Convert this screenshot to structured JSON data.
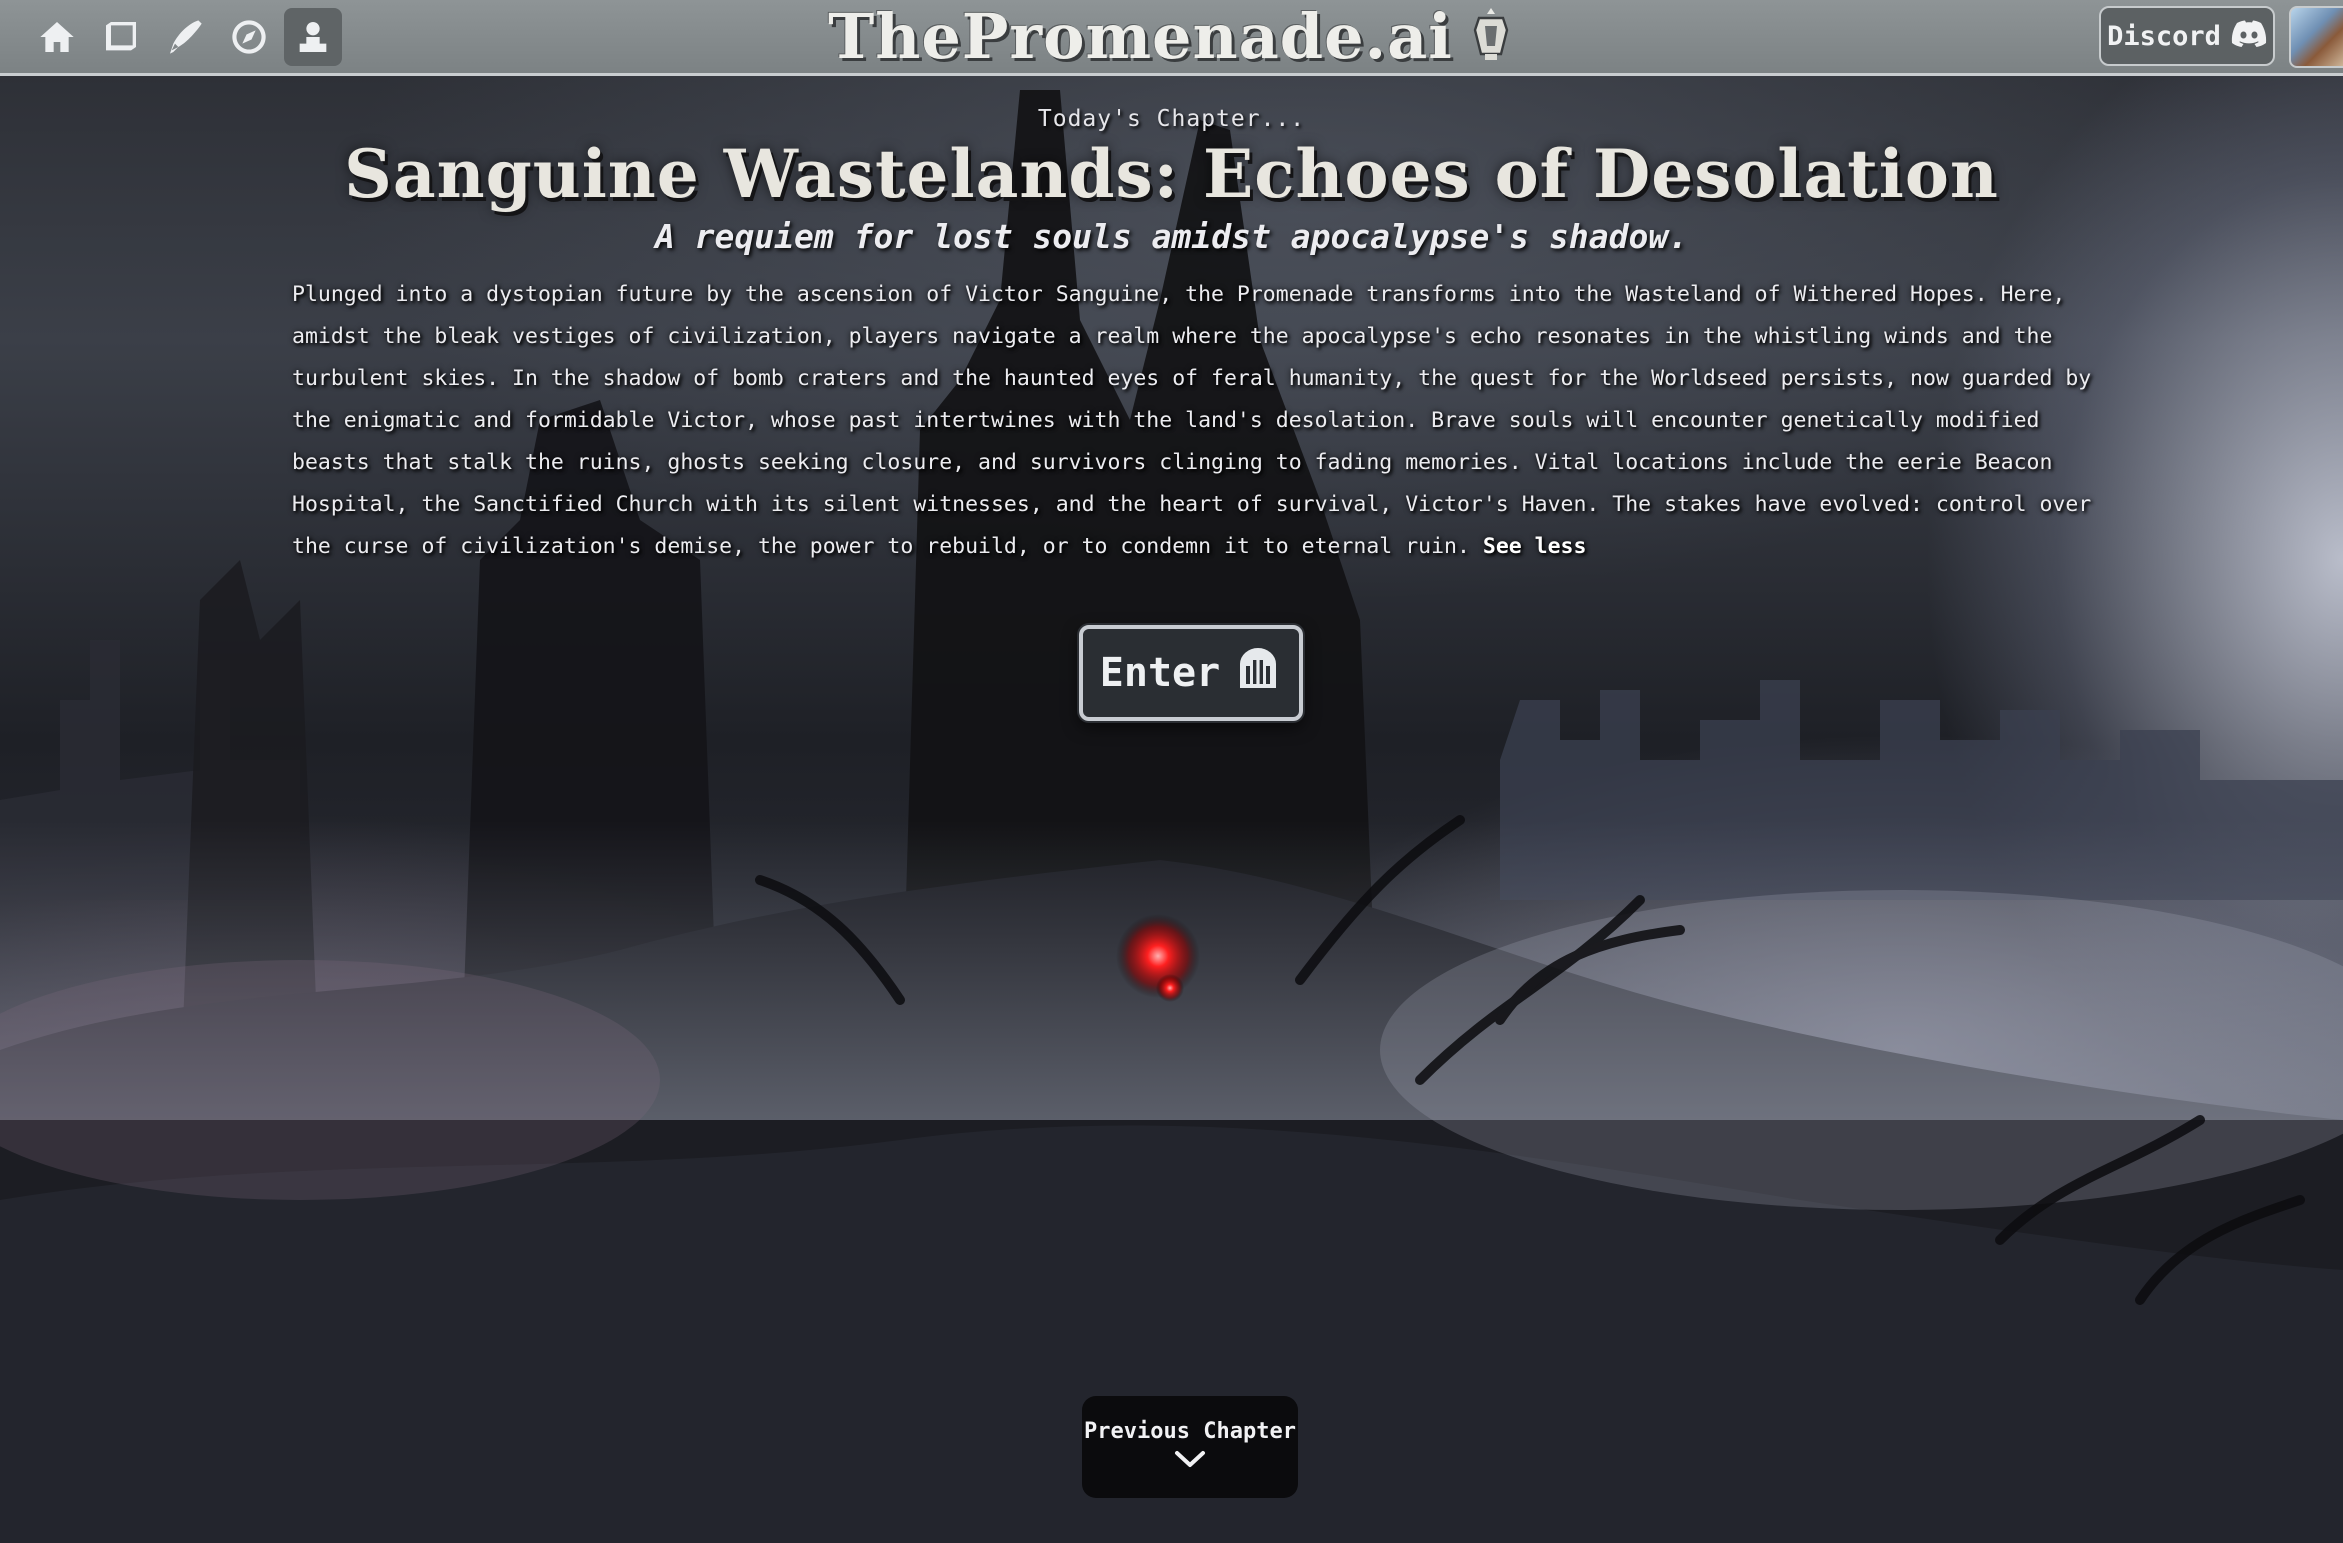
{
  "nav": {
    "icons": [
      "home-icon",
      "book-icon",
      "quill-icon",
      "compass-icon",
      "profile-icon"
    ],
    "active": "profile-icon"
  },
  "brand": {
    "name": "ThePromenade.ai",
    "logo_icon": "lantern-logo-icon"
  },
  "header_right": {
    "discord_label": "Discord",
    "discord_icon": "discord-icon"
  },
  "chapter": {
    "kicker": "Today's Chapter...",
    "title": "Sanguine Wastelands: Echoes of Desolation",
    "tagline": "A requiem for lost souls amidst apocalypse's shadow.",
    "description": "Plunged into a dystopian future by the ascension of Victor Sanguine, the Promenade transforms into the Wasteland of Withered Hopes. Here, amidst the bleak vestiges of civilization, players navigate a realm where the apocalypse's echo resonates in the whistling winds and the turbulent skies. In the shadow of bomb craters and the haunted eyes of feral humanity, the quest for the Worldseed persists, now guarded by the enigmatic and formidable Victor, whose past intertwines with the land's desolation. Brave souls will encounter genetically modified beasts that stalk the ruins, ghosts seeking closure, and survivors clinging to fading memories. Vital locations include the eerie Beacon Hospital, the Sanctified Church with its silent witnesses, and the heart of survival, Victor's Haven. The stakes have evolved: control over the curse of civilization's demise, the power to rebuild, or to condemn it to eternal ruin.",
    "see_less_label": "See less"
  },
  "actions": {
    "enter_label": "Enter",
    "enter_icon": "gate-icon",
    "previous_label": "Previous Chapter",
    "previous_icon": "chevron-down-icon"
  },
  "colors": {
    "topbar": "#868c8e",
    "accent_glow": "#ff1a1a"
  }
}
